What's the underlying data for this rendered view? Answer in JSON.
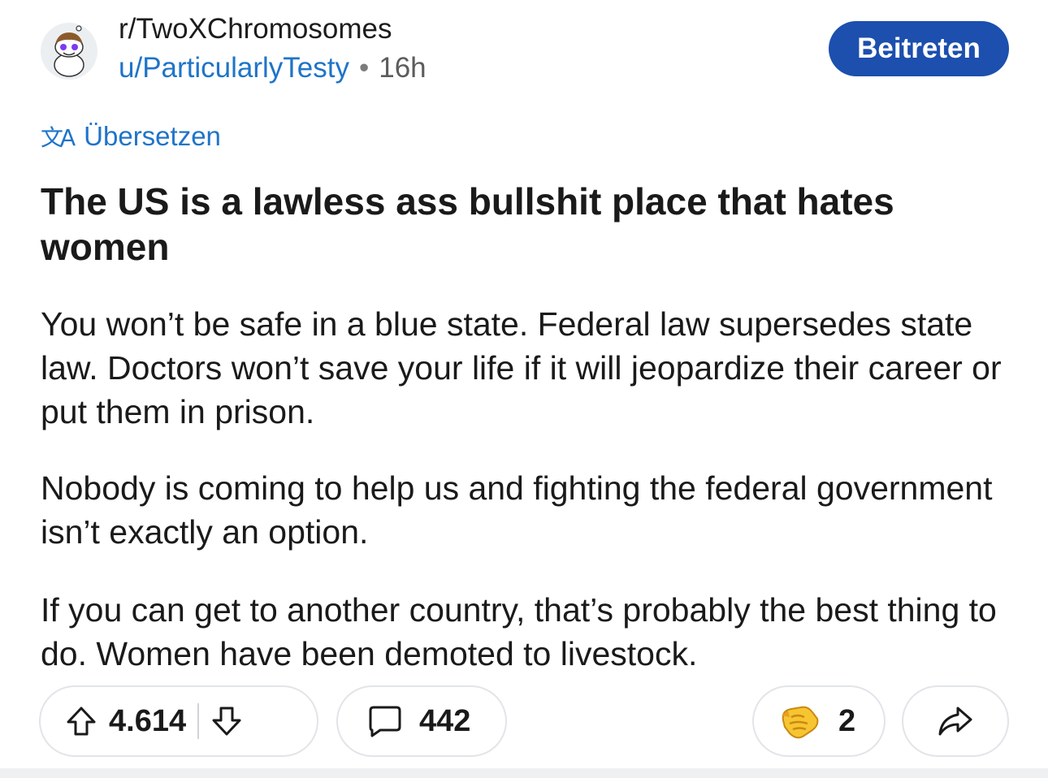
{
  "header": {
    "subreddit": "r/TwoXChromosomes",
    "username": "u/ParticularlyTesty",
    "separator": "•",
    "time_ago": "16h",
    "join_label": "Beitreten",
    "avatar_icon": "subreddit-snoo-avatar"
  },
  "translate": {
    "icon": "translate-icon",
    "glyph": "文A",
    "label": "Übersetzen"
  },
  "post": {
    "title": "The US is a lawless ass bullshit place that hates women",
    "paragraphs": [
      "You won’t be safe in a blue state. Federal law supersedes state law. Doctors won’t save your life if it will jeopardize their career or put them in prison.",
      "Nobody is coming to help us and fighting the federal government isn’t exactly an option.",
      "If you can get to another country, that’s probably the best thing to do. Women have been demoted to livestock."
    ]
  },
  "actions": {
    "upvote_icon": "upvote-arrow-icon",
    "score": "4.614",
    "downvote_icon": "downvote-arrow-icon",
    "comment_icon": "comment-bubble-icon",
    "comments": "442",
    "award_icon": "handshake-award-icon",
    "awards": "2",
    "share_icon": "share-arrow-icon"
  },
  "colors": {
    "accent_blue": "#1f74c9",
    "join_button": "#1c4fae",
    "text": "#1a1a1b",
    "pill_border": "#e2e4e8"
  }
}
